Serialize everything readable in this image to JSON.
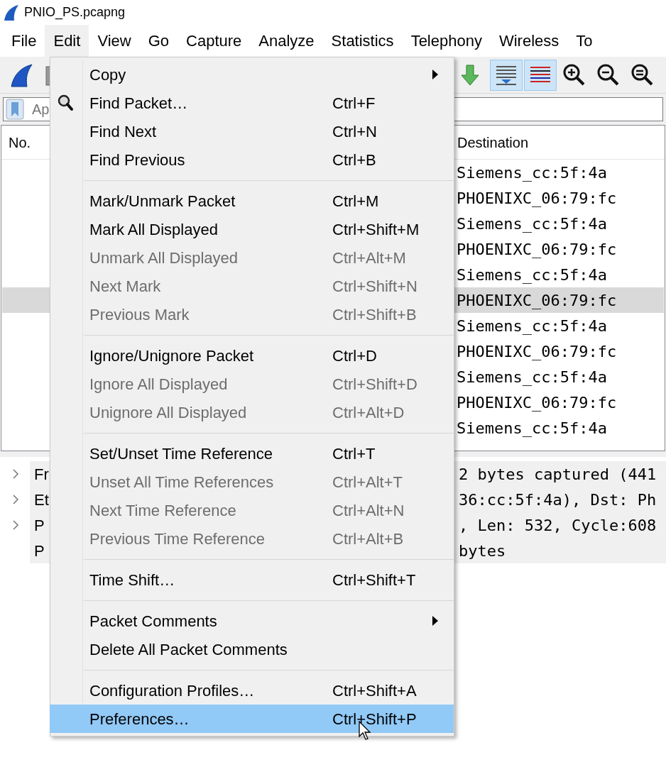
{
  "window": {
    "title": "PNIO_PS.pcapng"
  },
  "menu_bar": [
    {
      "label": "File",
      "selected": false
    },
    {
      "label": "Edit",
      "selected": true
    },
    {
      "label": "View",
      "selected": false
    },
    {
      "label": "Go",
      "selected": false
    },
    {
      "label": "Capture",
      "selected": false
    },
    {
      "label": "Analyze",
      "selected": false
    },
    {
      "label": "Statistics",
      "selected": false
    },
    {
      "label": "Telephony",
      "selected": false
    },
    {
      "label": "Wireless",
      "selected": false
    },
    {
      "label": "To",
      "selected": false
    }
  ],
  "toolbar": [
    {
      "kind": "fin",
      "pressed": false
    },
    {
      "kind": "stop",
      "pressed": false
    },
    {
      "kind": "download",
      "pressed": false
    },
    {
      "kind": "autoscroll",
      "pressed": true
    },
    {
      "kind": "colorize",
      "pressed": true
    },
    {
      "kind": "zoom_in",
      "pressed": false
    },
    {
      "kind": "zoom_out",
      "pressed": false
    },
    {
      "kind": "zoom_reset",
      "pressed": false
    }
  ],
  "filter": {
    "placeholder": "Ap"
  },
  "packet_list": {
    "columns": [
      "No.",
      "Destination"
    ],
    "rows": [
      {
        "destination": "Siemens_cc:5f:4a",
        "selected": false
      },
      {
        "destination": "PHOENIXC_06:79:fc",
        "selected": false
      },
      {
        "destination": "Siemens_cc:5f:4a",
        "selected": false
      },
      {
        "destination": "PHOENIXC_06:79:fc",
        "selected": false
      },
      {
        "destination": "Siemens_cc:5f:4a",
        "selected": false
      },
      {
        "destination": "PHOENIXC_06:79:fc",
        "selected": true
      },
      {
        "destination": "Siemens_cc:5f:4a",
        "selected": false
      },
      {
        "destination": "PHOENIXC_06:79:fc",
        "selected": false
      },
      {
        "destination": "Siemens_cc:5f:4a",
        "selected": false
      },
      {
        "destination": "PHOENIXC_06:79:fc",
        "selected": false
      },
      {
        "destination": "Siemens_cc:5f:4a",
        "selected": false
      }
    ]
  },
  "details": [
    {
      "expandable": true,
      "start": "Fr",
      "end": "2 bytes captured (441"
    },
    {
      "expandable": true,
      "start": "Et",
      "end": "36:cc:5f:4a), Dst: Ph"
    },
    {
      "expandable": true,
      "start": "P",
      "end": ", Len: 532, Cycle:608"
    },
    {
      "expandable": false,
      "start": "P",
      "end": "bytes"
    }
  ],
  "edit_menu": {
    "items": [
      {
        "kind": "item",
        "label": "Copy",
        "submenu": true,
        "disabled": false,
        "icon": false,
        "selected": false
      },
      {
        "kind": "item",
        "label": "Find Packet…",
        "shortcut": "Ctrl+F",
        "submenu": false,
        "disabled": false,
        "icon": true,
        "selected": false
      },
      {
        "kind": "item",
        "label": "Find Next",
        "shortcut": "Ctrl+N",
        "submenu": false,
        "disabled": false,
        "icon": false,
        "selected": false
      },
      {
        "kind": "item",
        "label": "Find Previous",
        "shortcut": "Ctrl+B",
        "submenu": false,
        "disabled": false,
        "icon": false,
        "selected": false
      },
      {
        "kind": "separator"
      },
      {
        "kind": "item",
        "label": "Mark/Unmark Packet",
        "shortcut": "Ctrl+M",
        "submenu": false,
        "disabled": false,
        "icon": false,
        "selected": false
      },
      {
        "kind": "item",
        "label": "Mark All Displayed",
        "shortcut": "Ctrl+Shift+M",
        "submenu": false,
        "disabled": false,
        "icon": false,
        "selected": false
      },
      {
        "kind": "item",
        "label": "Unmark All Displayed",
        "shortcut": "Ctrl+Alt+M",
        "submenu": false,
        "disabled": true,
        "icon": false,
        "selected": false
      },
      {
        "kind": "item",
        "label": "Next Mark",
        "shortcut": "Ctrl+Shift+N",
        "submenu": false,
        "disabled": true,
        "icon": false,
        "selected": false
      },
      {
        "kind": "item",
        "label": "Previous Mark",
        "shortcut": "Ctrl+Shift+B",
        "submenu": false,
        "disabled": true,
        "icon": false,
        "selected": false
      },
      {
        "kind": "separator"
      },
      {
        "kind": "item",
        "label": "Ignore/Unignore Packet",
        "shortcut": "Ctrl+D",
        "submenu": false,
        "disabled": false,
        "icon": false,
        "selected": false
      },
      {
        "kind": "item",
        "label": "Ignore All Displayed",
        "shortcut": "Ctrl+Shift+D",
        "submenu": false,
        "disabled": true,
        "icon": false,
        "selected": false
      },
      {
        "kind": "item",
        "label": "Unignore All Displayed",
        "shortcut": "Ctrl+Alt+D",
        "submenu": false,
        "disabled": true,
        "icon": false,
        "selected": false
      },
      {
        "kind": "separator"
      },
      {
        "kind": "item",
        "label": "Set/Unset Time Reference",
        "shortcut": "Ctrl+T",
        "submenu": false,
        "disabled": false,
        "icon": false,
        "selected": false
      },
      {
        "kind": "item",
        "label": "Unset All Time References",
        "shortcut": "Ctrl+Alt+T",
        "submenu": false,
        "disabled": true,
        "icon": false,
        "selected": false
      },
      {
        "kind": "item",
        "label": "Next Time Reference",
        "shortcut": "Ctrl+Alt+N",
        "submenu": false,
        "disabled": true,
        "icon": false,
        "selected": false
      },
      {
        "kind": "item",
        "label": "Previous Time Reference",
        "shortcut": "Ctrl+Alt+B",
        "submenu": false,
        "disabled": true,
        "icon": false,
        "selected": false
      },
      {
        "kind": "separator"
      },
      {
        "kind": "item",
        "label": "Time Shift…",
        "shortcut": "Ctrl+Shift+T",
        "submenu": false,
        "disabled": false,
        "icon": false,
        "selected": false
      },
      {
        "kind": "separator"
      },
      {
        "kind": "item",
        "label": "Packet Comments",
        "submenu": true,
        "disabled": false,
        "icon": false,
        "selected": false
      },
      {
        "kind": "item",
        "label": "Delete All Packet Comments",
        "submenu": false,
        "disabled": false,
        "icon": false,
        "selected": false
      },
      {
        "kind": "separator"
      },
      {
        "kind": "item",
        "label": "Configuration Profiles…",
        "shortcut": "Ctrl+Shift+A",
        "submenu": false,
        "disabled": false,
        "icon": false,
        "selected": false
      },
      {
        "kind": "item",
        "label": "Preferences…",
        "shortcut": "Ctrl+Shift+P",
        "submenu": false,
        "disabled": false,
        "icon": false,
        "selected": true
      }
    ]
  }
}
